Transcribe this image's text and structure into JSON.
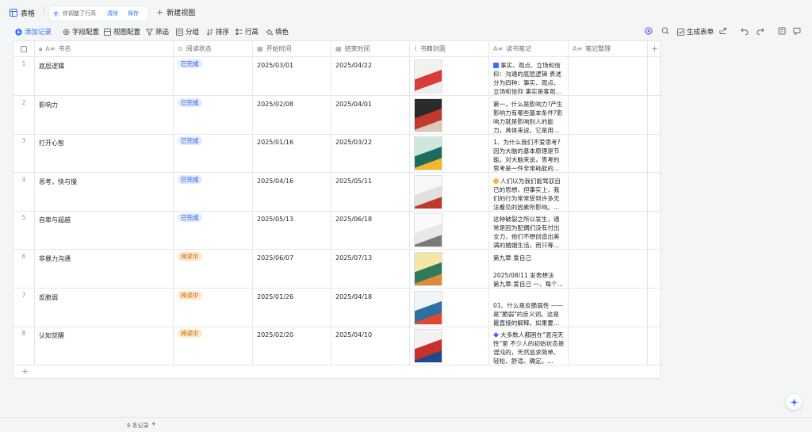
{
  "tabbar": {
    "table_label": "表格",
    "more_label": "⋮",
    "view_chip_text": "你调整了行高",
    "view_chip_clear": "清除",
    "view_chip_save": "保存",
    "new_view_label": "新建视图"
  },
  "toolbar": {
    "add_record": "添加记录",
    "field_config": "字段配置",
    "view_config": "视图配置",
    "filter": "筛选",
    "group": "分组",
    "sort": "排序",
    "row_height": "行高",
    "fill_color": "填色",
    "generate_form": "生成表单"
  },
  "columns": [
    {
      "name": "书名",
      "icon": "text-icon"
    },
    {
      "name": "阅读状态",
      "icon": "single-select-icon"
    },
    {
      "name": "开始时间",
      "icon": "calendar-icon"
    },
    {
      "name": "结束时间",
      "icon": "calendar-icon"
    },
    {
      "name": "书籍封面",
      "icon": "attachment-icon"
    },
    {
      "name": "读书笔记",
      "icon": "text-icon"
    },
    {
      "name": "笔记整理",
      "icon": "text-icon"
    }
  ],
  "rows": [
    {
      "num": "1",
      "title": "底层逻辑",
      "status": "已完成",
      "status_type": "done",
      "start": "2025/03/01",
      "end": "2025/04/22",
      "note": "事实、观点、立场和信仰：沟通的底层逻辑 表述分为四种：事实、观点、立场和信仰 事实是客观...",
      "note_emoji": "blue",
      "cover_colors": [
        "#f3f1ee",
        "#d93a3a",
        "#eeeeee"
      ]
    },
    {
      "num": "2",
      "title": "影响力",
      "status": "已完成",
      "status_type": "done",
      "start": "2025/02/08",
      "end": "2025/04/01",
      "note": "第一，什么是影响力?产生影响力有哪些基本条件?影响力就是影响别人的能力，具体来说，它是用...",
      "note_emoji": "",
      "cover_colors": [
        "#2b2b2b",
        "#c23a2a",
        "#d9cbb8"
      ]
    },
    {
      "num": "3",
      "title": "打开心智",
      "status": "已完成",
      "status_type": "done",
      "start": "2025/01/16",
      "end": "2025/03/22",
      "note": "1、为什么我们不爱思考?因为大脑的基本原理是节能。对大脑来说，思考的思考是一件非常耗能的...",
      "note_emoji": "",
      "cover_colors": [
        "#cfe6dd",
        "#1d6b5e",
        "#f1b82d"
      ]
    },
    {
      "num": "4",
      "title": "思考，快与慢",
      "status": "已完成",
      "status_type": "done",
      "start": "2025/04/16",
      "end": "2025/05/11",
      "note": "人们以为我们能驾驭自己的思想，但事实上，我们的行为常常受到许多无法看见的因素所影响。...",
      "note_emoji": "sun",
      "cover_colors": [
        "#f7f7f7",
        "#e0e0e0",
        "#c0392b"
      ]
    },
    {
      "num": "5",
      "title": "自卑与超越",
      "status": "已完成",
      "status_type": "done",
      "start": "2025/05/13",
      "end": "2025/06/18",
      "note": "这种破裂之所以发生，通常是因为配偶们没有付出全力，他们不想创造出美满的婚姻生活，而只等...",
      "note_emoji": "",
      "cover_colors": [
        "#fafafa",
        "#e8e8e8",
        "#7a7a7a"
      ]
    },
    {
      "num": "6",
      "title": "非暴力沟通",
      "status": "阅读中",
      "status_type": "reading",
      "start": "2025/06/07",
      "end": "2025/07/13",
      "note": "第九章 爱自己\n\n2025/08/11 发表想法\n第九章.爱自己 一、每个...",
      "note_emoji": "",
      "cover_colors": [
        "#f5e6a8",
        "#2f7a5a",
        "#d98c3a"
      ]
    },
    {
      "num": "7",
      "title": "反脆弱",
      "status": "阅读中",
      "status_type": "reading",
      "start": "2025/01/26",
      "end": "2025/04/18",
      "note": "\n01、什么是反脆弱性 ——是\"脆弱\"的反义词。这是最直接的解释，如果要...",
      "note_emoji": "",
      "cover_colors": [
        "#f2f5f7",
        "#2d6ea3",
        "#e2472f"
      ]
    },
    {
      "num": "8",
      "title": "认知觉醒",
      "status": "阅读中",
      "status_type": "reading",
      "start": "2025/02/20",
      "end": "2025/04/10",
      "note": "大多数人都困在\"混沌天性\"里 不少人的初始状态是混沌的，天然追求简单、轻松、舒适、确定。...",
      "note_emoji": "diamond",
      "cover_colors": [
        "#f2f2f2",
        "#c9302c",
        "#1e4a8c"
      ]
    }
  ],
  "footer": {
    "record_count": "8 条记录"
  },
  "colors": {
    "accent": "#3370ff",
    "done_bg": "#e1eaff",
    "reading_bg": "#fee7cd"
  }
}
